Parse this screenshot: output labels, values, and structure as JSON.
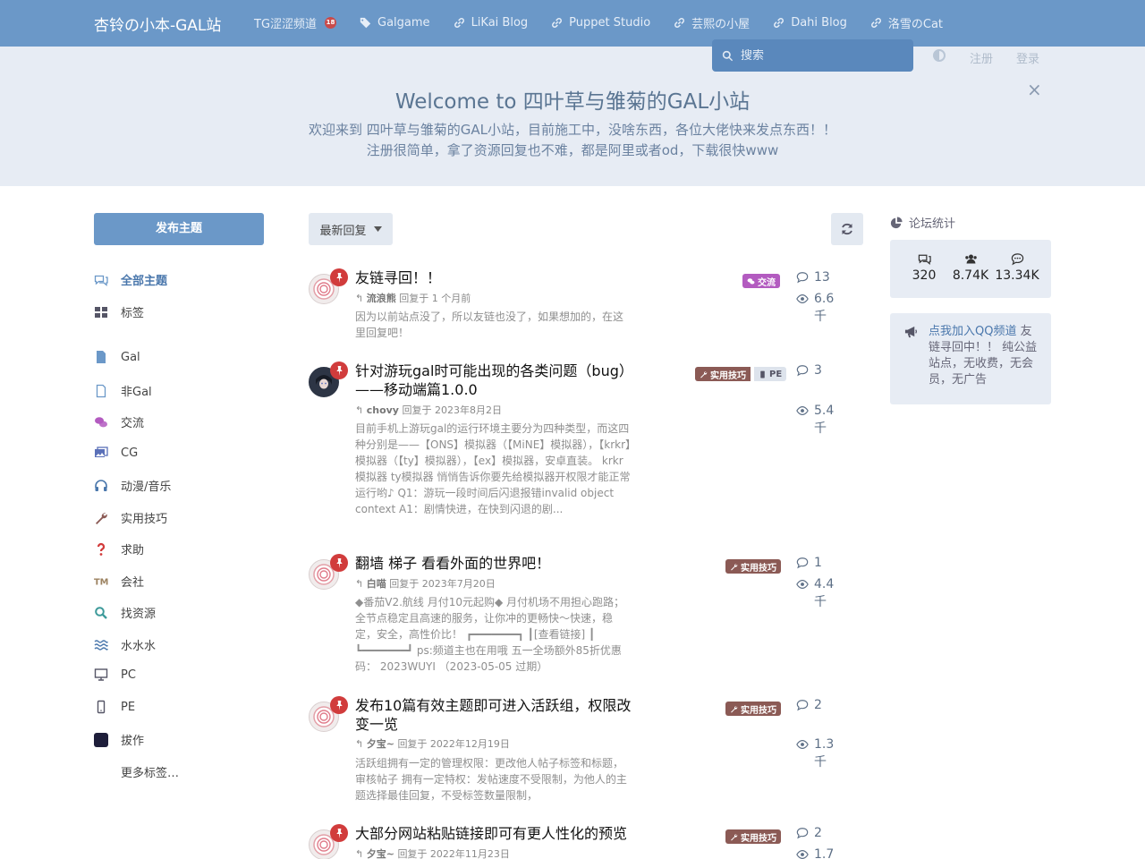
{
  "header": {
    "brand": "杏铃の小本-GAL站",
    "nav": [
      {
        "label": "TG涩涩频道",
        "icon": "telegram-badge-18"
      },
      {
        "label": "Galgame",
        "icon": "tag-icon"
      },
      {
        "label": "LiKai Blog",
        "icon": "link-icon"
      },
      {
        "label": "Puppet Studio",
        "icon": "link-icon"
      },
      {
        "label": "芸熙の小屋",
        "icon": "link-icon"
      },
      {
        "label": "Dahi Blog",
        "icon": "link-icon"
      },
      {
        "label": "洛雪のCat",
        "icon": "link-icon"
      }
    ],
    "badge18": "18",
    "search_placeholder": "搜索",
    "register": "注册",
    "login": "登录"
  },
  "hero": {
    "title": "Welcome to 四叶草与雏菊的GAL小站",
    "line1": "欢迎来到 四叶草与雏菊的GAL小站，目前施工中，没啥东西，各位大佬快来发点东西！！",
    "line2": "注册很简单，拿了资源回复也不难，都是阿里或者od，下载很快www",
    "close": "×"
  },
  "sidebar": {
    "post_button": "发布主题",
    "items": [
      {
        "label": "全部主题",
        "icon": "comments-icon",
        "color": "#4a77ac"
      },
      {
        "label": "标签",
        "icon": "tags-grid-icon",
        "color": "#556"
      },
      {
        "label": "Gal",
        "icon": "file-icon",
        "color": "#6b98c8"
      },
      {
        "label": "非Gal",
        "icon": "file-outline-icon",
        "color": "#6b98c8"
      },
      {
        "label": "交流",
        "icon": "chat-icon",
        "color": "#b35bc0"
      },
      {
        "label": "CG",
        "icon": "images-icon",
        "color": "#5a70b8"
      },
      {
        "label": "动漫/音乐",
        "icon": "headphones-icon",
        "color": "#4a77ac"
      },
      {
        "label": "实用技巧",
        "icon": "wrench-icon",
        "color": "#8b5a55"
      },
      {
        "label": "求助",
        "icon": "question-icon",
        "color": "#d23a3a"
      },
      {
        "label": "会社",
        "icon": "trademark-icon",
        "color": "#9c8260"
      },
      {
        "label": "找资源",
        "icon": "search-icon",
        "color": "#3d9a9a"
      },
      {
        "label": "水水水",
        "icon": "water-icon",
        "color": "#4a77ac"
      },
      {
        "label": "PC",
        "icon": "desktop-icon",
        "color": "#556"
      },
      {
        "label": "PE",
        "icon": "mobile-icon",
        "color": "#556"
      },
      {
        "label": "拔作",
        "icon": "square-icon",
        "color": "#1e1e3a"
      },
      {
        "label": "更多标签…",
        "icon": "",
        "color": ""
      }
    ]
  },
  "toolbar": {
    "sort_label": "最新回复"
  },
  "discussions": [
    {
      "title": "友链寻回！！",
      "user": "流浪熊",
      "meta": "回复于 1 个月前",
      "excerpt": "因为以前站点没了，所以友链也没了，如果想加的，在这里回复吧！",
      "tags": [
        {
          "label": "交流",
          "icon": "chat-icon",
          "color": "#b35bc0"
        }
      ],
      "replies": "13",
      "views": "6.6千"
    },
    {
      "title": "针对游玩gal时可能出现的各类问题（bug）——移动端篇1.0.0",
      "user": "chovy",
      "meta": "回复于 2023年8月2日",
      "excerpt": "目前手机上游玩gal的运行环境主要分为四种类型，而这四种分别是——【ONS】模拟器（【MiNE】模拟器），【krkr】模拟器（【ty】模拟器），【ex】模拟器，安卓直装。 krkr模拟器 ty模拟器 悄悄告诉你要先给模拟器开权限才能正常运行哟♪ Q1：游玩一段时间后闪退报错invalid object context A1：剧情快进，在快到闪退的剧...",
      "tags": [
        {
          "label": "实用技巧",
          "icon": "wrench-icon",
          "color": "#8b5a55"
        },
        {
          "label": "PE",
          "icon": "mobile-icon",
          "color": "#c8d0dc"
        }
      ],
      "replies": "3",
      "views": "5.4千"
    },
    {
      "title": "翻墙 梯子 看看外面的世界吧！",
      "user": "白喵",
      "meta": "回复于 2023年7月20日",
      "excerpt": "◆番茄V2.航线 月付10元起购◆ 月付机场不用担心跑路；全节点稳定且高速的服务，让你冲的更畅快～快速，稳定，安全，高性价比！ ┏━━━━━━━┓ ┃[查看链接] ┃ ┗━━━━━━━┛ ps:频道主也在用哦 五一全场额外85折优惠码： 2023WUYI （2023-05-05 过期）",
      "tags": [
        {
          "label": "实用技巧",
          "icon": "wrench-icon",
          "color": "#8b5a55"
        }
      ],
      "replies": "1",
      "views": "4.4千"
    },
    {
      "title": "发布10篇有效主题即可进入活跃组，权限改变一览",
      "user": "夕宝~",
      "meta": "回复于 2022年12月19日",
      "excerpt": "活跃组拥有一定的管理权限：更改他人帖子标签和标题，审核帖子 拥有一定特权：发帖速度不受限制，为他人的主题选择最佳回复，不受标签数量限制，",
      "tags": [
        {
          "label": "实用技巧",
          "icon": "wrench-icon",
          "color": "#8b5a55"
        }
      ],
      "replies": "2",
      "views": "1.3千"
    },
    {
      "title": "大部分网站粘贴链接即可有更人性化的预览",
      "user": "夕宝~",
      "meta": "回复于 2022年11月23日",
      "excerpt": "",
      "tags": [
        {
          "label": "实用技巧",
          "icon": "wrench-icon",
          "color": "#8b5a55"
        }
      ],
      "replies": "2",
      "views": "1.7"
    }
  ],
  "right_panel": {
    "title": "论坛统计",
    "stats": [
      {
        "icon": "comments-icon",
        "value": "320"
      },
      {
        "icon": "users-icon",
        "value": "8.74K"
      },
      {
        "icon": "comment-dots-icon",
        "value": "13.34K"
      }
    ],
    "announce_link": "点我加入QQ频道",
    "announce_rest": " 友链寻回中！！ 纯公益站点，无收费，无会员，无广告"
  }
}
